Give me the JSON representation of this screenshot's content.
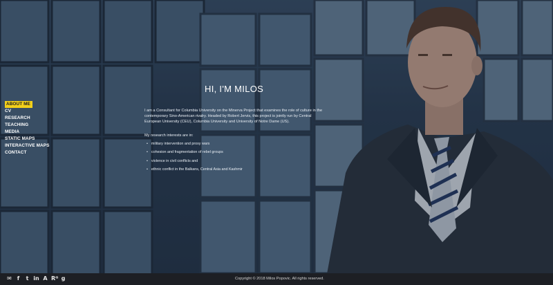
{
  "nav": {
    "items": [
      {
        "label": "ABOUT ME",
        "active": true
      },
      {
        "label": "CV"
      },
      {
        "label": "RESEARCH"
      },
      {
        "label": "TEACHING"
      },
      {
        "label": "MEDIA"
      },
      {
        "label": "STATIC MAPS"
      },
      {
        "label": "INTERACTIVE MAPS"
      },
      {
        "label": "CONTACT"
      }
    ]
  },
  "main": {
    "heading": "HI, I'M MILOS",
    "intro": "I am a Consultant for Columbia University on the Minerva Project that examines the role of culture in the contemporary Sino-American rivalry. Headed by Robert Jervis, this project is jointly run by Central European University (CEU), Columbia University and University of Notre Dame (US).",
    "interests_label": "My research interests are in:",
    "interests": [
      "military intervention and proxy wars",
      "cohesion and fragmentation of rebel groups",
      "violence in civil conflicts and",
      "ethnic conflict in the Balkans, Central Asia and Kashmir"
    ]
  },
  "footer": {
    "social": [
      {
        "icon": "email-icon",
        "glyph": "✉"
      },
      {
        "icon": "facebook-icon",
        "glyph": "f"
      },
      {
        "icon": "twitter-icon",
        "glyph": "t"
      },
      {
        "icon": "linkedin-icon",
        "glyph": "in"
      },
      {
        "icon": "academia-icon",
        "glyph": "A"
      },
      {
        "icon": "researchgate-icon",
        "glyph": "Rᴳ"
      },
      {
        "icon": "google-scholar-icon",
        "glyph": "g"
      }
    ],
    "copyright": "Copyright © 2018 Milos Popovic. All rights reserved."
  },
  "colors": {
    "accent": "#f2cf1a",
    "footer_bg": "#1d1f24",
    "text": "#ffffff"
  }
}
